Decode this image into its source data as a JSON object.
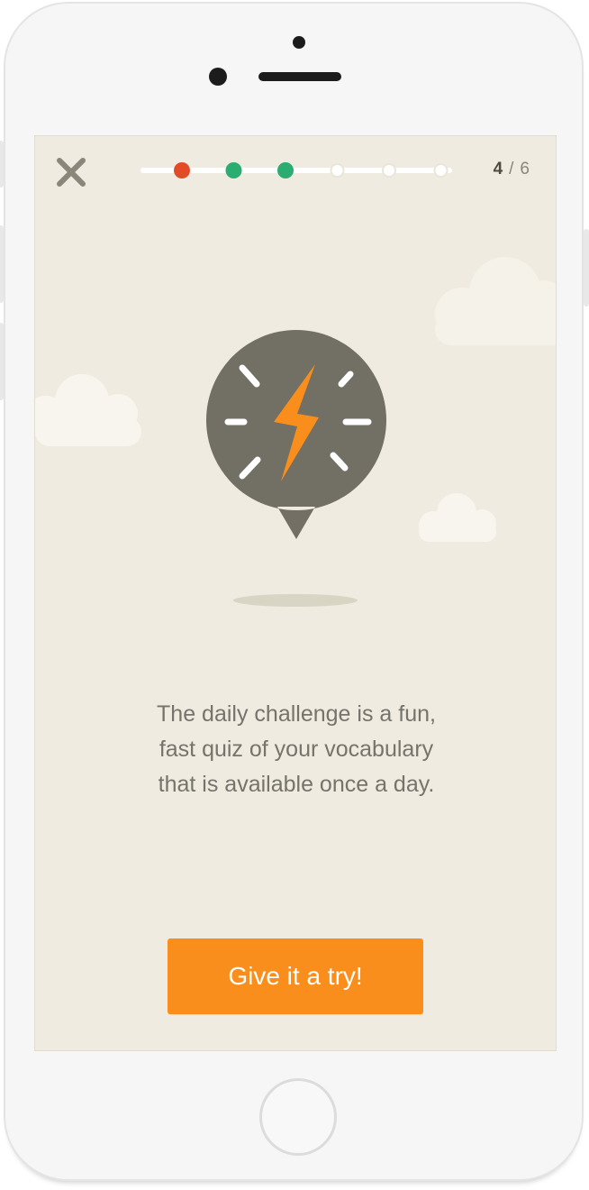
{
  "header": {
    "close_icon": "close-icon",
    "progress": {
      "total": 6,
      "current": 4,
      "steps": [
        {
          "index": 1,
          "status": "incorrect",
          "color": "#e24b28"
        },
        {
          "index": 2,
          "status": "correct",
          "color": "#2bad72"
        },
        {
          "index": 3,
          "status": "correct",
          "color": "#2bad72"
        },
        {
          "index": 4,
          "status": "pending",
          "color": "#ffffff"
        },
        {
          "index": 5,
          "status": "pending",
          "color": "#ffffff"
        },
        {
          "index": 6,
          "status": "pending",
          "color": "#ffffff"
        }
      ]
    },
    "counter": {
      "current": "4",
      "separator": "/",
      "total": "6"
    }
  },
  "illustration": {
    "icon": "lightning-timer-bubble-icon",
    "bubble_color": "#726f64",
    "bolt_color": "#f98e1d"
  },
  "body": {
    "lines": [
      "The daily challenge is a fun,",
      "fast quiz of your vocabulary",
      "that is available once a day."
    ]
  },
  "cta": {
    "label": "Give it a try!",
    "color": "#f98e1d"
  },
  "colors": {
    "screen_background": "#efebe0",
    "text": "#75736b"
  }
}
